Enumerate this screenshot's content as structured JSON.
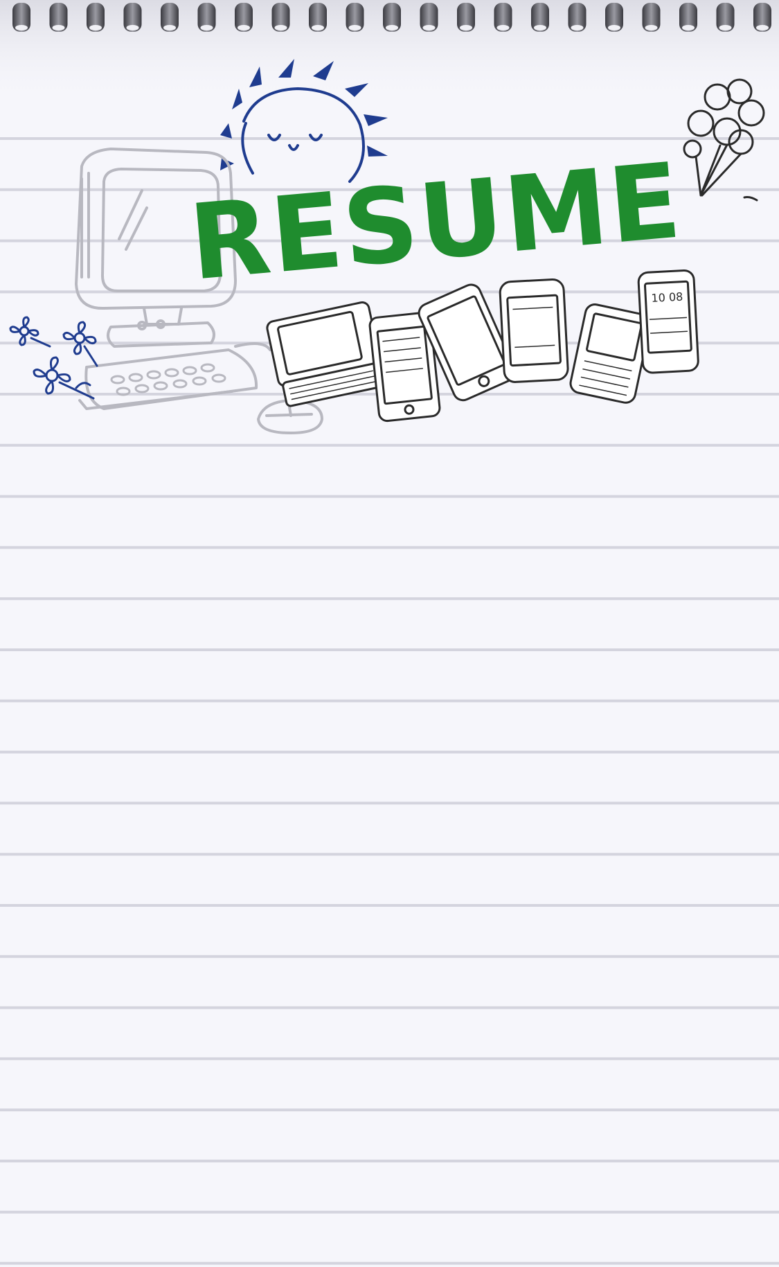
{
  "page": {
    "title": "RESUME",
    "clock_text": "10 08"
  },
  "colors": {
    "paper": "#f6f6fb",
    "rule_line": "#d4d4de",
    "spiral": "#5a5a60",
    "title_green": "#1f8c2e",
    "doodle_blue": "#1f3c8f",
    "sketch_gray": "#b8b8c0",
    "ink_dark": "#2a2a2a"
  },
  "icons": [
    "spiral-binding-icon",
    "sun-icon",
    "computer-icon",
    "flowers-icon",
    "balloons-icon",
    "phone-icon"
  ]
}
